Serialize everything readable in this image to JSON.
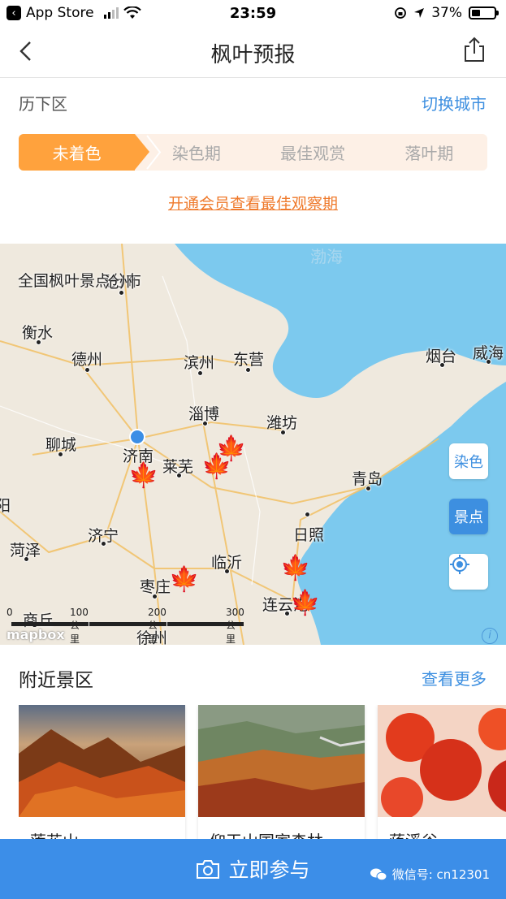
{
  "status_bar": {
    "back_app": "App Store",
    "time": "23:59",
    "battery": "37%"
  },
  "nav": {
    "title": "枫叶预报"
  },
  "city": {
    "name": "历下区",
    "switch_label": "切换城市"
  },
  "stages": {
    "items": [
      "未着色",
      "染色期",
      "最佳观赏",
      "落叶期"
    ],
    "active_index": 0
  },
  "vip_link": "开通会员查看最佳观察期",
  "map": {
    "sea_label": "渤海",
    "national_label": "全国枫叶景点分布",
    "cities": [
      "沧州",
      "衡水",
      "德州",
      "滨州",
      "东营",
      "烟台",
      "威海",
      "淄博",
      "潍坊",
      "聊城",
      "济南",
      "莱芜",
      "青岛",
      "菏泽",
      "济宁",
      "日照",
      "临沂",
      "枣庄",
      "连云港",
      "商丘",
      "徐州",
      "阳"
    ],
    "controls": {
      "dye_label": "染色",
      "spot_label": "景点",
      "active": "景点"
    },
    "scale": [
      "0",
      "100公里",
      "200公里",
      "300公里"
    ],
    "attribution": "mapbox"
  },
  "nearby": {
    "title": "附近景区",
    "see_more": "查看更多",
    "spots": [
      "莲花山",
      "仰天山国家森林",
      "蒋溪谷"
    ]
  },
  "cta": {
    "label": "立即参与"
  },
  "watermark": {
    "text": "微信号: cn12301"
  },
  "colors": {
    "accent_blue": "#3c8ee8",
    "accent_orange": "#ffa23d",
    "leaf": "#f07a1b"
  }
}
